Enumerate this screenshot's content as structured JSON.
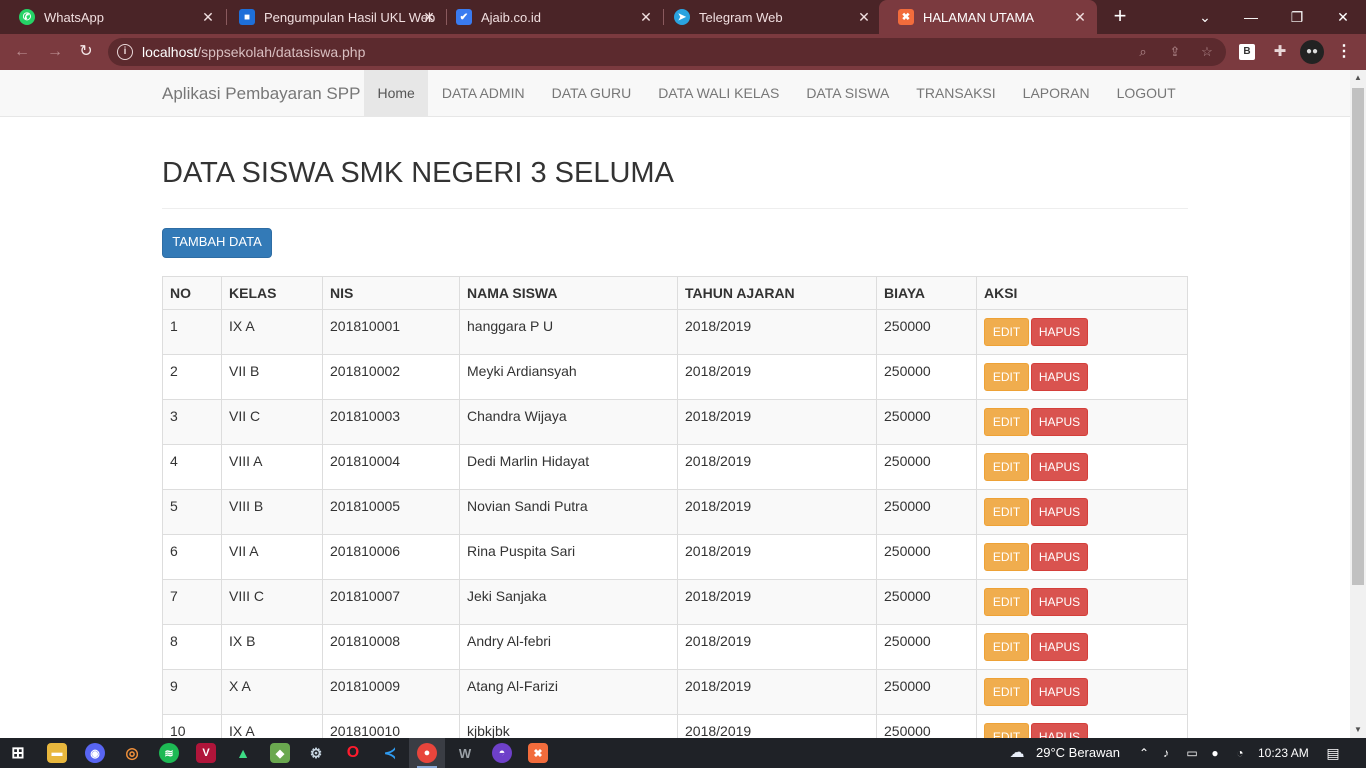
{
  "browser": {
    "tabs": [
      {
        "title": "WhatsApp",
        "favicon": "whatsapp-icon",
        "color": "#25d366",
        "active": false
      },
      {
        "title": "Pengumpulan Hasil UKL Web",
        "favicon": "classroom-icon",
        "color": "#1e6fd9",
        "active": false
      },
      {
        "title": "Ajaib.co.id",
        "favicon": "ajaib-icon",
        "color": "#3a7bf0",
        "active": false
      },
      {
        "title": "Telegram Web",
        "favicon": "telegram-icon",
        "color": "#2aa3e0",
        "active": false
      },
      {
        "title": "HALAMAN UTAMA",
        "favicon": "xampp-icon",
        "color": "#f26c3c",
        "active": true
      }
    ],
    "url_host": "localhost",
    "url_path": "/sppsekolah/datasiswa.php",
    "extension_b_label": "B"
  },
  "app": {
    "brand": "Aplikasi Pembayaran SPP",
    "nav": [
      {
        "label": "Home",
        "active": true
      },
      {
        "label": "DATA ADMIN",
        "active": false
      },
      {
        "label": "DATA GURU",
        "active": false
      },
      {
        "label": "DATA WALI KELAS",
        "active": false
      },
      {
        "label": "DATA SISWA",
        "active": false
      },
      {
        "label": "TRANSAKSI",
        "active": false
      },
      {
        "label": "LAPORAN",
        "active": false
      },
      {
        "label": "LOGOUT",
        "active": false
      }
    ],
    "page_title": "DATA SISWA SMK NEGERI 3 SELUMA",
    "add_button": "TAMBAH DATA",
    "table": {
      "headers": [
        "NO",
        "KELAS",
        "NIS",
        "NAMA SISWA",
        "TAHUN AJARAN",
        "BIAYA",
        "AKSI"
      ],
      "edit_label": "EDIT",
      "delete_label": "HAPUS",
      "rows": [
        {
          "no": "1",
          "kelas": "IX A",
          "nis": "201810001",
          "nama": "hanggara P U",
          "tahun": "2018/2019",
          "biaya": "250000"
        },
        {
          "no": "2",
          "kelas": "VII B",
          "nis": "201810002",
          "nama": "Meyki Ardiansyah",
          "tahun": "2018/2019",
          "biaya": "250000"
        },
        {
          "no": "3",
          "kelas": "VII C",
          "nis": "201810003",
          "nama": "Chandra Wijaya",
          "tahun": "2018/2019",
          "biaya": "250000"
        },
        {
          "no": "4",
          "kelas": "VIII A",
          "nis": "201810004",
          "nama": "Dedi Marlin Hidayat",
          "tahun": "2018/2019",
          "biaya": "250000"
        },
        {
          "no": "5",
          "kelas": "VIII B",
          "nis": "201810005",
          "nama": "Novian Sandi Putra",
          "tahun": "2018/2019",
          "biaya": "250000"
        },
        {
          "no": "6",
          "kelas": "VII A",
          "nis": "201810006",
          "nama": "Rina Puspita Sari",
          "tahun": "2018/2019",
          "biaya": "250000"
        },
        {
          "no": "7",
          "kelas": "VIII C",
          "nis": "201810007",
          "nama": "Jeki Sanjaka",
          "tahun": "2018/2019",
          "biaya": "250000"
        },
        {
          "no": "8",
          "kelas": "IX B",
          "nis": "201810008",
          "nama": "Andry Al-febri",
          "tahun": "2018/2019",
          "biaya": "250000"
        },
        {
          "no": "9",
          "kelas": "X A",
          "nis": "201810009",
          "nama": "Atang Al-Farizi",
          "tahun": "2018/2019",
          "biaya": "250000"
        },
        {
          "no": "10",
          "kelas": "IX A",
          "nis": "201810010",
          "nama": "kjbkjbk",
          "tahun": "2018/2019",
          "biaya": "250000"
        }
      ]
    }
  },
  "taskbar": {
    "weather": "29°C  Berawan",
    "time": "10:23 AM"
  }
}
